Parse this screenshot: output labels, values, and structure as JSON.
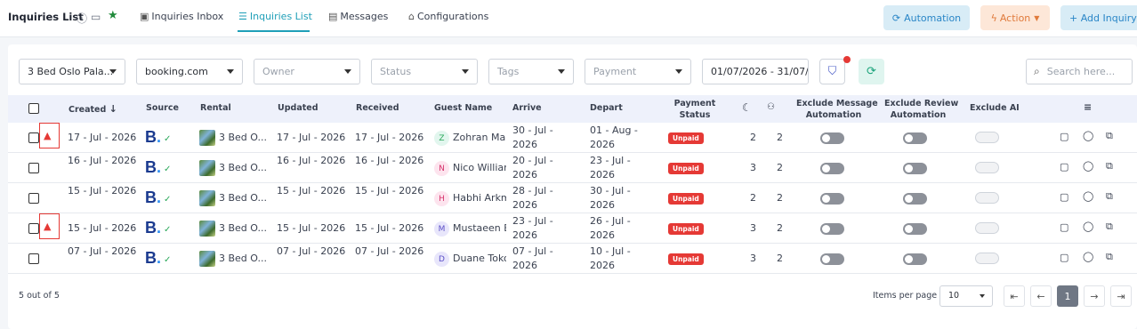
{
  "header": {
    "title": "Inquiries List",
    "tabs": [
      {
        "label": "Inquiries Inbox",
        "icon": "inbox-icon"
      },
      {
        "label": "Inquiries List",
        "icon": "list-icon",
        "active": true
      },
      {
        "label": "Messages",
        "icon": "message-icon"
      },
      {
        "label": "Configurations",
        "icon": "configurations-icon"
      }
    ],
    "automation_label": "Automation",
    "action_label": "Action",
    "add_inquiry_label": "+ Add Inquiry"
  },
  "filters": {
    "rental": "3 Bed Oslo Pala...",
    "source": "booking.com",
    "owner_placeholder": "Owner",
    "status_placeholder": "Status",
    "tags_placeholder": "Tags",
    "payment_placeholder": "Payment",
    "date_range": "01/07/2026 - 31/07/",
    "search_placeholder": "Search here..."
  },
  "table": {
    "columns": {
      "created": "Created",
      "source": "Source",
      "rental": "Rental",
      "updated": "Updated",
      "received": "Received",
      "guest_name": "Guest Name",
      "arrive": "Arrive",
      "depart": "Depart",
      "payment_status_1": "Payment",
      "payment_status_2": "Status",
      "exclude_msg_1": "Exclude Message",
      "exclude_msg_2": "Automation",
      "exclude_review_1": "Exclude Review",
      "exclude_review_2": "Automation",
      "exclude_ai": "Exclude AI"
    },
    "rows": [
      {
        "warning": true,
        "created": "17 - Jul - 2026",
        "source": "B.",
        "rental": "3 Bed O...",
        "updated": "17 - Jul - 2026",
        "received": "17 - Jul - 2026",
        "guest_initial": "Z",
        "guest": "Zohran Mar",
        "arrive": "30 - Jul - 2026",
        "depart": "01 - Aug - 2026",
        "payment": "Unpaid",
        "nights": "2",
        "guests": "2"
      },
      {
        "warning": false,
        "created": "16 - Jul - 2026",
        "source": "B.",
        "rental": "3 Bed O...",
        "updated": "16 - Jul - 2026",
        "received": "16 - Jul - 2026",
        "guest_initial": "N",
        "guest": "Nico Willian",
        "arrive": "20 - Jul - 2026",
        "depart": "23 - Jul - 2026",
        "payment": "Unpaid",
        "nights": "3",
        "guests": "2"
      },
      {
        "warning": false,
        "created": "15 - Jul - 2026",
        "source": "B.",
        "rental": "3 Bed O...",
        "updated": "15 - Jul - 2026",
        "received": "15 - Jul - 2026",
        "guest_initial": "H",
        "guest": "Habhi Arkm",
        "arrive": "28 - Jul - 2026",
        "depart": "30 - Jul - 2026",
        "payment": "Unpaid",
        "nights": "2",
        "guests": "2"
      },
      {
        "warning": true,
        "created": "15 - Jul - 2026",
        "source": "B.",
        "rental": "3 Bed O...",
        "updated": "15 - Jul - 2026",
        "received": "15 - Jul - 2026",
        "guest_initial": "M",
        "guest": "Mustaeen E",
        "arrive": "23 - Jul - 2026",
        "depart": "26 - Jul - 2026",
        "payment": "Unpaid",
        "nights": "3",
        "guests": "2"
      },
      {
        "warning": false,
        "created": "07 - Jul - 2026",
        "source": "B.",
        "rental": "3 Bed O...",
        "updated": "07 - Jul - 2026",
        "received": "07 - Jul - 2026",
        "guest_initial": "D",
        "guest": "Duane Toko",
        "arrive": "07 - Jul - 2026",
        "depart": "10 - Jul - 2026",
        "payment": "Unpaid",
        "nights": "3",
        "guests": "2"
      }
    ]
  },
  "footer": {
    "count": "5 out of 5",
    "items_per_page_label": "Items per page",
    "items_per_page": "10",
    "current_page": "1"
  },
  "colors": {
    "accent": "#1f9fb8",
    "unpaid": "#e53935",
    "header_bg": "#eef1fb"
  }
}
